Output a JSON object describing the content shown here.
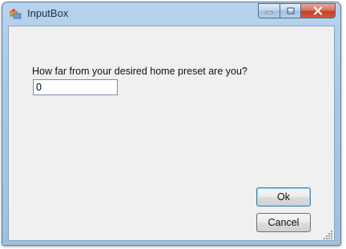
{
  "window": {
    "title": "InputBox",
    "controls": {
      "minimize_icon": "minimize-icon",
      "maximize_icon": "maximize-icon",
      "close_icon": "close-icon"
    }
  },
  "dialog": {
    "prompt": "How far from your desired home preset are you?",
    "input_value": "0",
    "ok_label": "Ok",
    "cancel_label": "Cancel"
  },
  "colors": {
    "titlebar": "#a9c8e6",
    "client_background": "#f0f0f0",
    "close_button": "#c2412a"
  }
}
